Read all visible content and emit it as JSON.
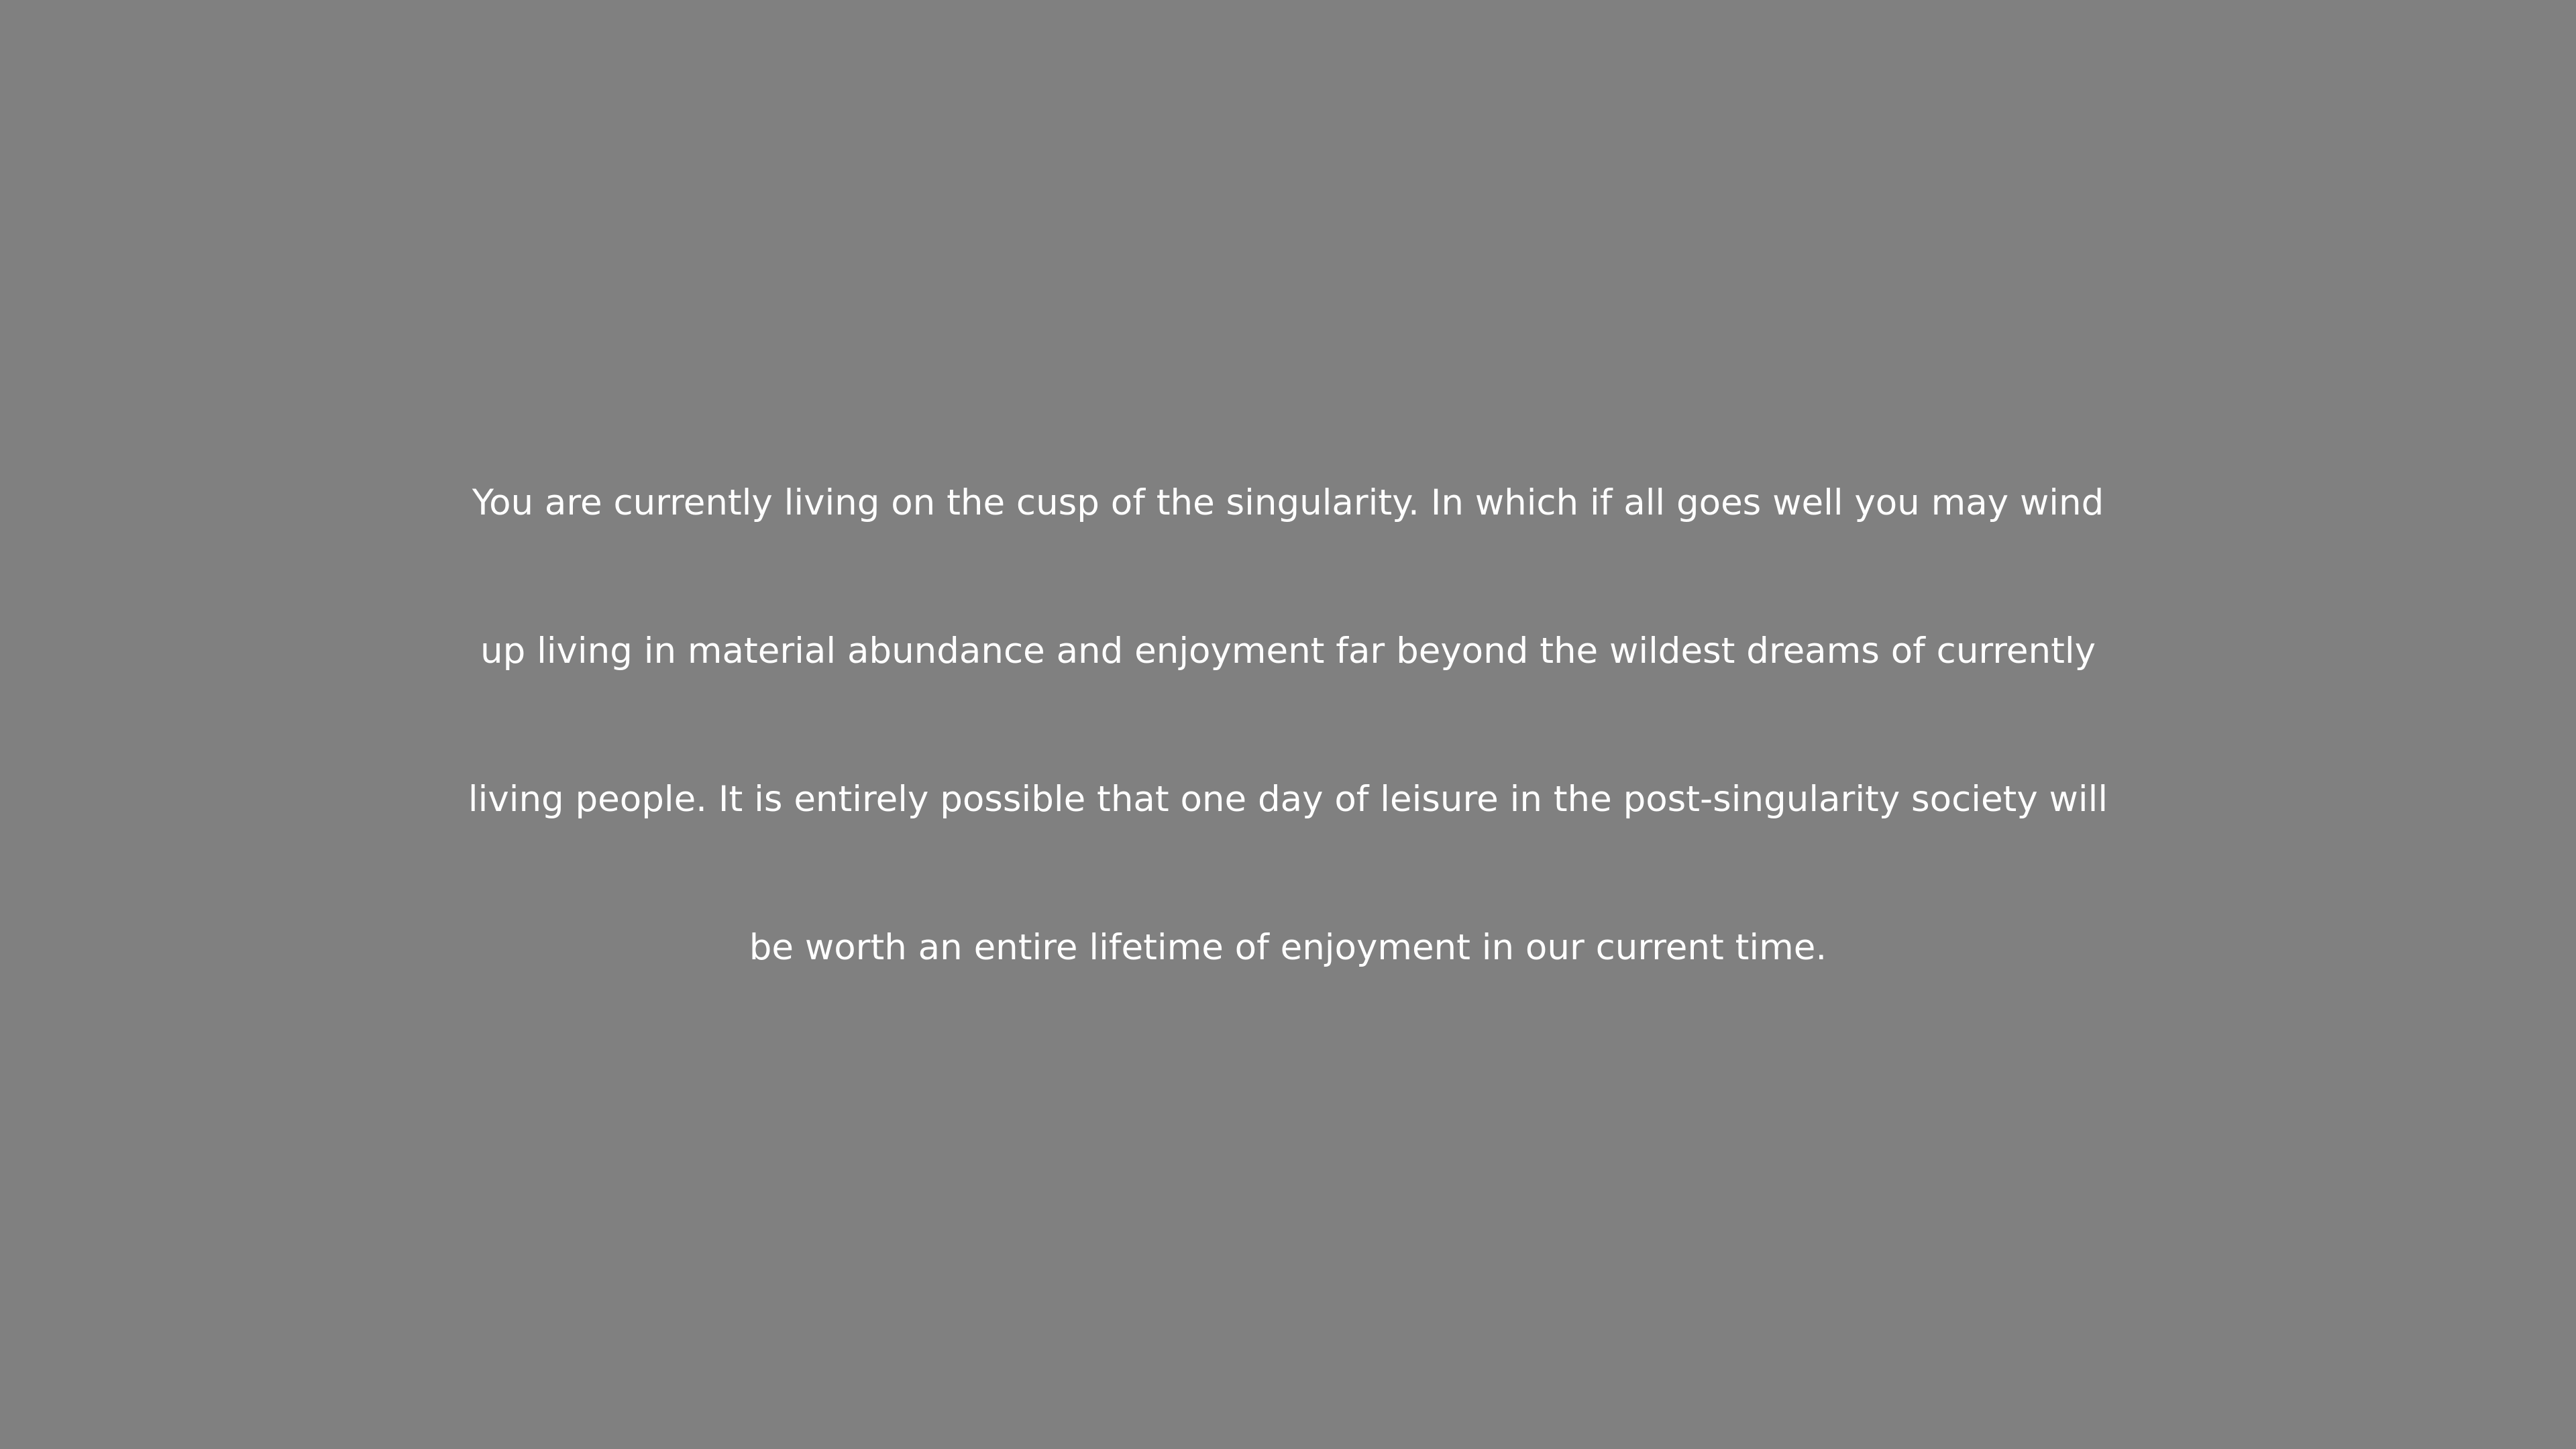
{
  "message": {
    "lines": [
      "You are currently living on the cusp of the singularity. In which if all goes well you may wind",
      "up living in material abundance and enjoyment far beyond the wildest dreams of currently",
      "living people. It is entirely possible that one day of leisure in the post-singularity society will",
      "be worth an entire lifetime of enjoyment in our current time."
    ]
  },
  "colors": {
    "background": "#808080",
    "text": "#ffffff"
  }
}
